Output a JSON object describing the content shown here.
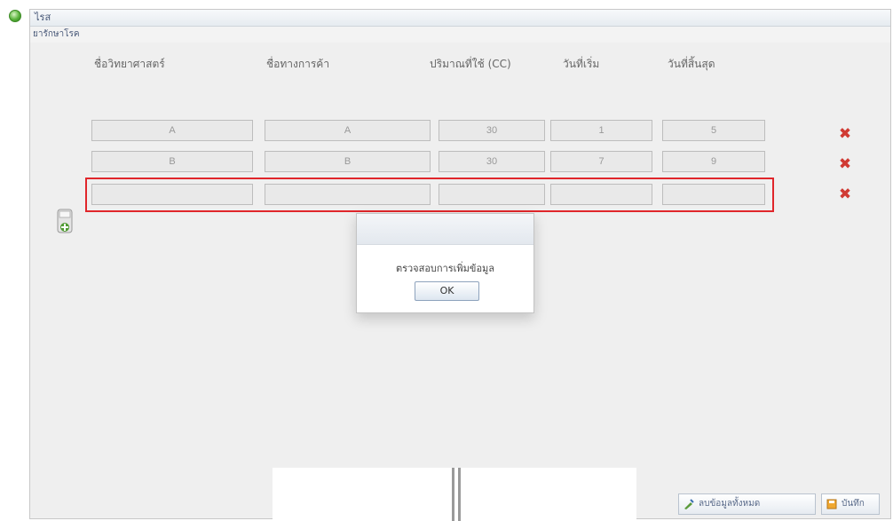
{
  "window": {
    "title": "ไรส",
    "subtitle": "ยารักษาโรค"
  },
  "table": {
    "headers": [
      "ชื่อวิทยาศาสตร์",
      "ชื่อทางการค้า",
      "ปริมาณที่ใช้ (CC)",
      "วันที่เริ่ม",
      "วันที่สิ้นสุด"
    ],
    "rows": [
      [
        "A",
        "A",
        "30",
        "1",
        "5"
      ],
      [
        "B",
        "B",
        "30",
        "7",
        "9"
      ],
      [
        "",
        "",
        "",
        "",
        ""
      ]
    ]
  },
  "dialog": {
    "message": "ตรวจสอบการเพิ่มข้อมูล",
    "ok_label": "OK"
  },
  "footer": {
    "clear_label": "ลบข้อมูลทั้งหมด",
    "save_label": "บันทึก"
  },
  "colors": {
    "delete": "#d03a33",
    "highlight": "#e0262b"
  }
}
